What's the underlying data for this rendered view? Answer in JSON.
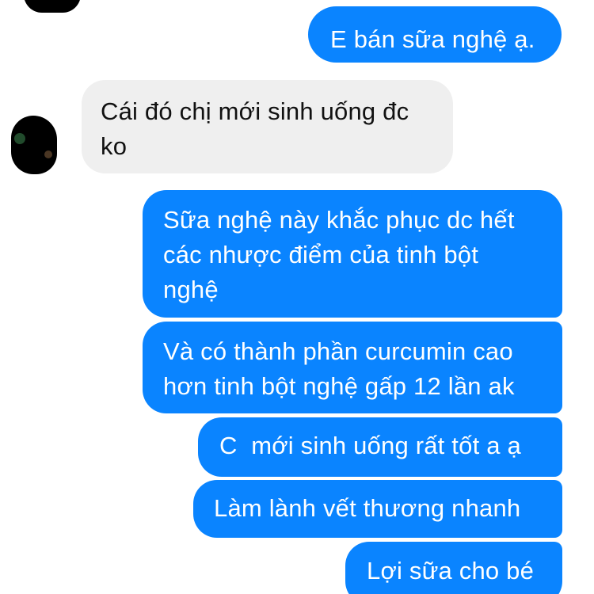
{
  "conversation": {
    "messages": [
      {
        "direction": "outgoing",
        "lines": [
          "E bán sữa nghệ ạ."
        ]
      },
      {
        "direction": "incoming",
        "lines": [
          "Cái đó chị mới sinh uống đc",
          "ko"
        ]
      },
      {
        "direction": "outgoing",
        "lines": [
          "Sữa nghệ này khắc phục dc hết",
          "các nhược điểm của tinh bột",
          "nghệ"
        ]
      },
      {
        "direction": "outgoing",
        "lines": [
          "Và có thành phần curcumin cao",
          "hơn tinh bột nghệ gấp 12 lần ak"
        ]
      },
      {
        "direction": "outgoing",
        "lines": [
          "C  mới sinh uống rất tốt a ạ"
        ]
      },
      {
        "direction": "outgoing",
        "lines": [
          "Làm lành vết thương nhanh"
        ]
      },
      {
        "direction": "outgoing",
        "lines": [
          "Lợi sữa cho bé"
        ]
      }
    ]
  },
  "colors": {
    "outgoing_bubble": "#0a84ff",
    "incoming_bubble": "#efefef",
    "outgoing_text": "#ffffff",
    "incoming_text": "#111111",
    "background": "#ffffff"
  },
  "icons": {
    "contact_avatar": "redacted-avatar"
  }
}
